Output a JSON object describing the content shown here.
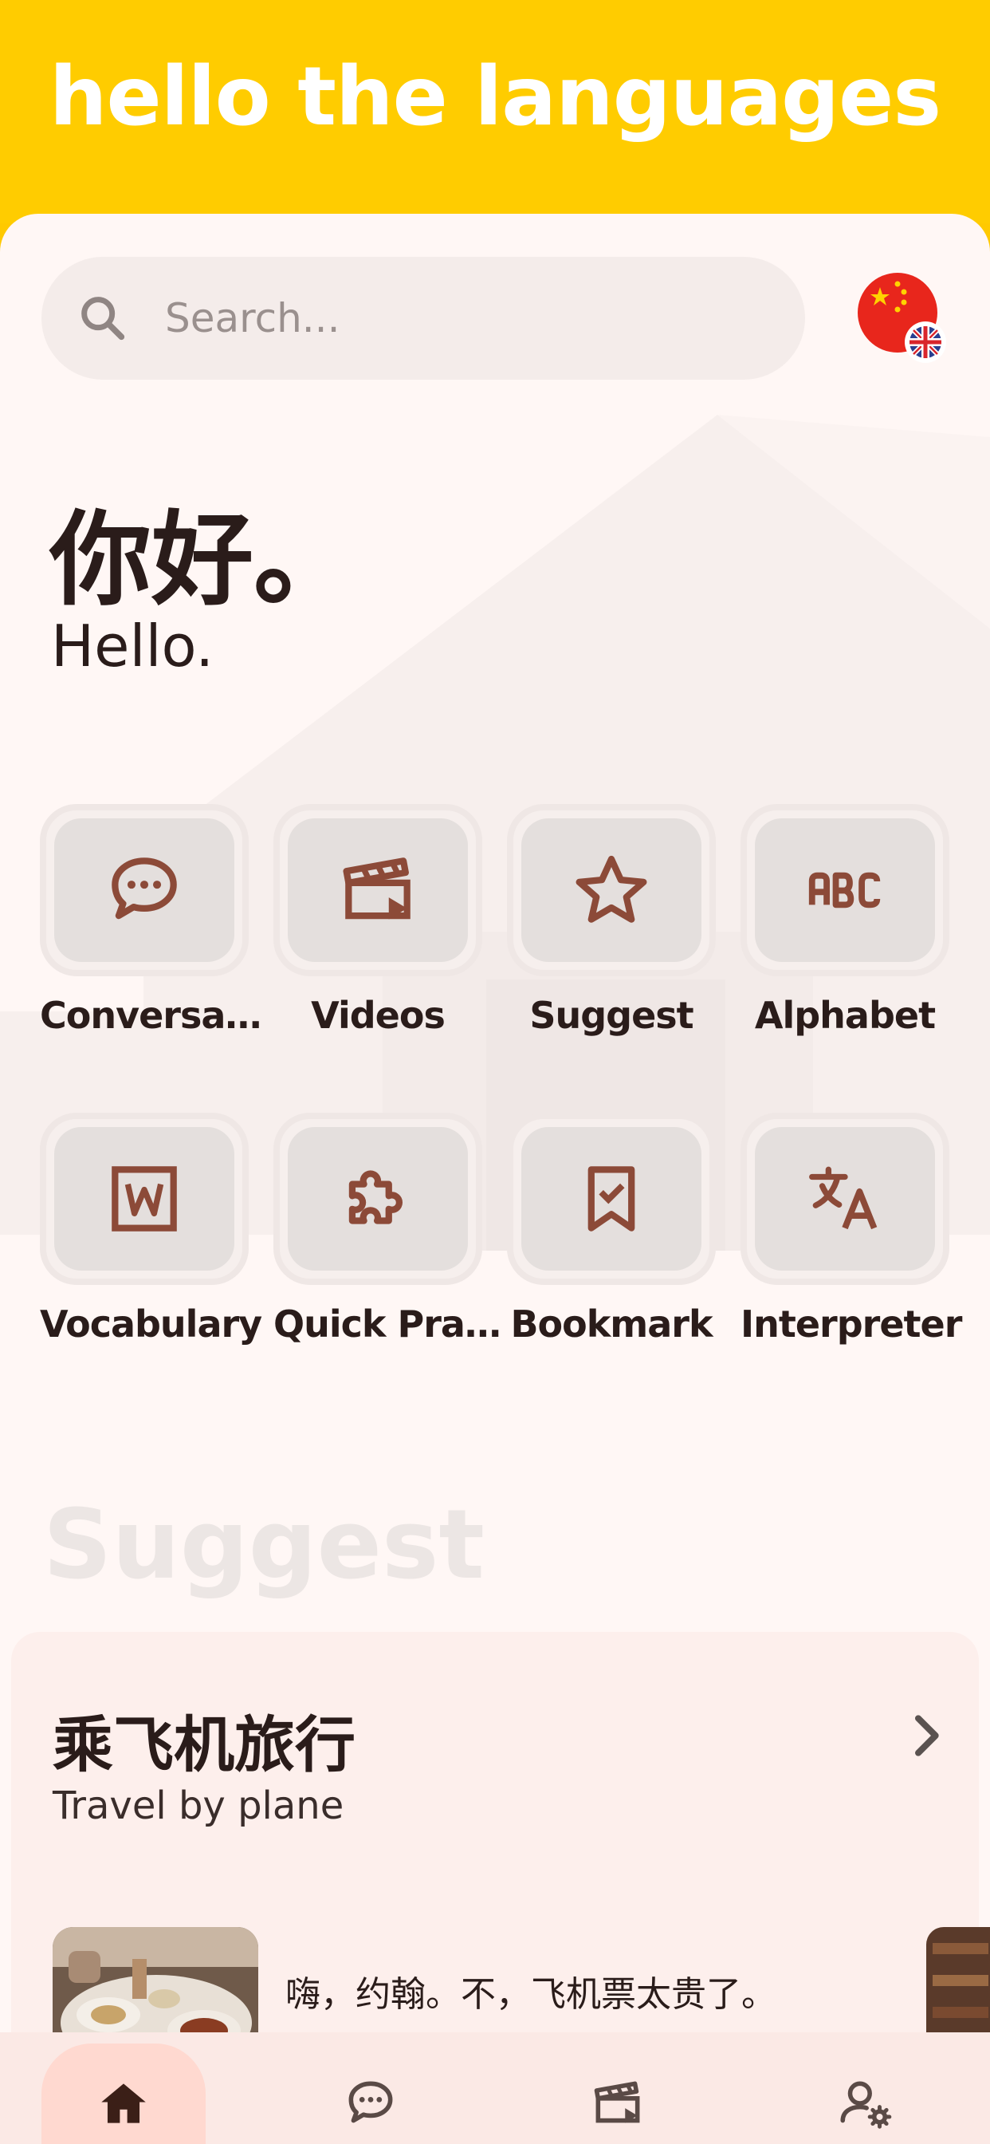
{
  "app": {
    "title": "hello the languages"
  },
  "search": {
    "placeholder": "Search..."
  },
  "language": {
    "primary_flag": "china-flag-icon",
    "secondary_flag": "uk-flag-icon"
  },
  "greeting": {
    "native": "你好。",
    "translation": "Hello."
  },
  "menu": {
    "items": [
      {
        "label": "Conversa…",
        "icon": "chat-icon"
      },
      {
        "label": "Videos",
        "icon": "clapperboard-icon"
      },
      {
        "label": "Suggest",
        "icon": "star-icon"
      },
      {
        "label": "Alphabet",
        "icon": "abc-icon"
      },
      {
        "label": "Vocabulary",
        "icon": "word-icon"
      },
      {
        "label": "Quick Pra…",
        "icon": "puzzle-icon"
      },
      {
        "label": "Bookmark",
        "icon": "bookmark-check-icon"
      },
      {
        "label": "Interpreter",
        "icon": "translate-icon"
      }
    ]
  },
  "suggest": {
    "section_title": "Suggest",
    "card": {
      "title": "乘飞机旅行",
      "subtitle": "Travel by plane",
      "dialogue": "嗨，约翰。不，飞机票太贵了。"
    }
  },
  "nav": {
    "items": [
      {
        "icon": "home-icon",
        "active": true
      },
      {
        "icon": "chat-icon",
        "active": false
      },
      {
        "icon": "clapperboard-icon",
        "active": false
      },
      {
        "icon": "user-settings-icon",
        "active": false
      }
    ]
  },
  "colors": {
    "header": "#ffcc00",
    "background": "#fff7f5",
    "accent_icon": "#8c4a38",
    "text": "#2a1c1a",
    "nav_background": "#fbe9e5",
    "nav_active": "#ffd9d0"
  }
}
